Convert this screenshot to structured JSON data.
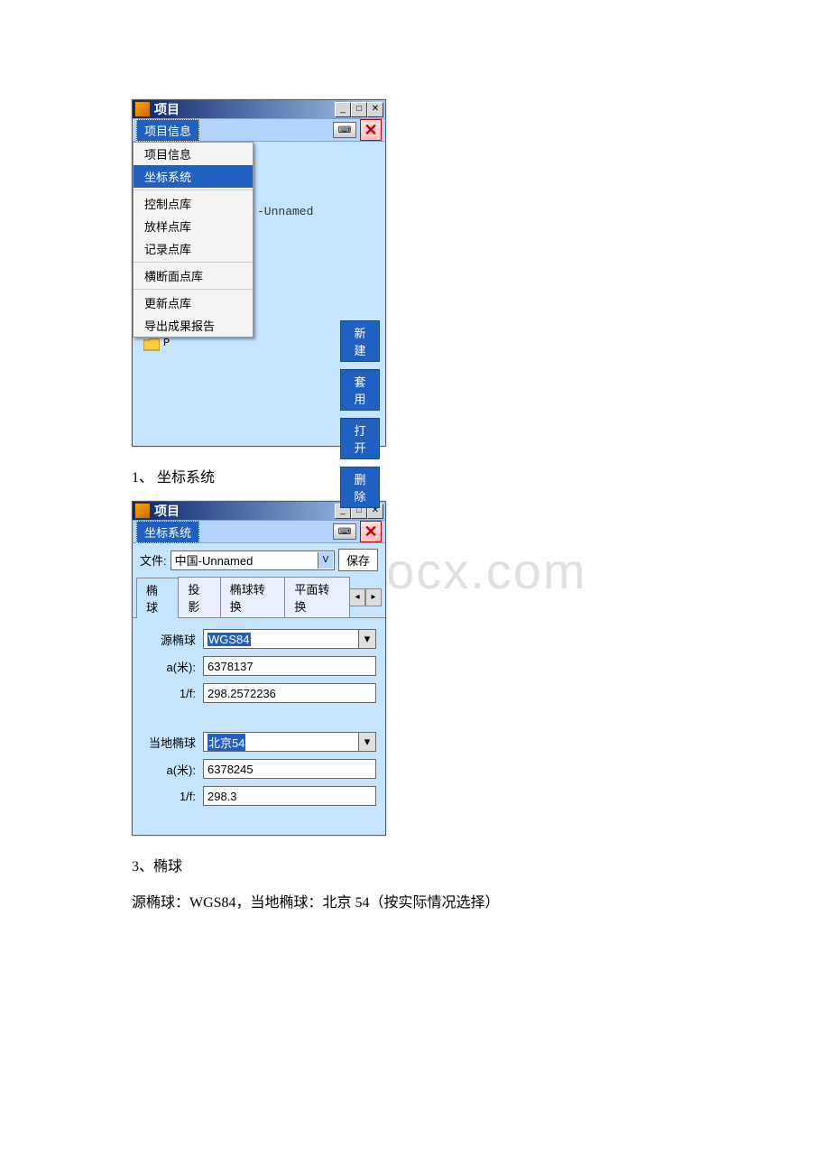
{
  "watermark": "www.bdocx.com",
  "window1": {
    "title": "项目",
    "menu_active": "项目信息",
    "dropdown": {
      "item_info": "项目信息",
      "item_coord": "坐标系统",
      "item_ctrl": "控制点库",
      "item_stake": "放样点库",
      "item_record": "记录点库",
      "item_cross": "横断面点库",
      "item_update": "更新点库",
      "item_export": "导出成果报告"
    },
    "unnamed_text": "-Unnamed",
    "folder_label": "P",
    "side_buttons": {
      "new": "新建",
      "apply": "套用",
      "open": "打开",
      "delete": "删除"
    }
  },
  "caption1": "1、 坐标系统",
  "window2": {
    "title": "项目",
    "menu_active": "坐标系统",
    "file_label": "文件:",
    "file_value": "中国-Unnamed",
    "save_label": "保存",
    "tabs": {
      "t1": "椭球",
      "t2": "投影",
      "t3": "椭球转换",
      "t4": "平面转换"
    },
    "form": {
      "src_ellipsoid_label": "源椭球",
      "src_ellipsoid_value": "WGS84",
      "src_a_label": "a(米):",
      "src_a_value": "6378137",
      "src_1f_label": "1/f:",
      "src_1f_value": "298.2572236",
      "local_ellipsoid_label": "当地椭球",
      "local_ellipsoid_value": "北京54",
      "local_a_label": "a(米):",
      "local_a_value": "6378245",
      "local_1f_label": "1/f:",
      "local_1f_value": "298.3"
    }
  },
  "caption2": "3、椭球",
  "caption3": "源椭球：WGS84，当地椭球：北京 54（按实际情况选择）"
}
